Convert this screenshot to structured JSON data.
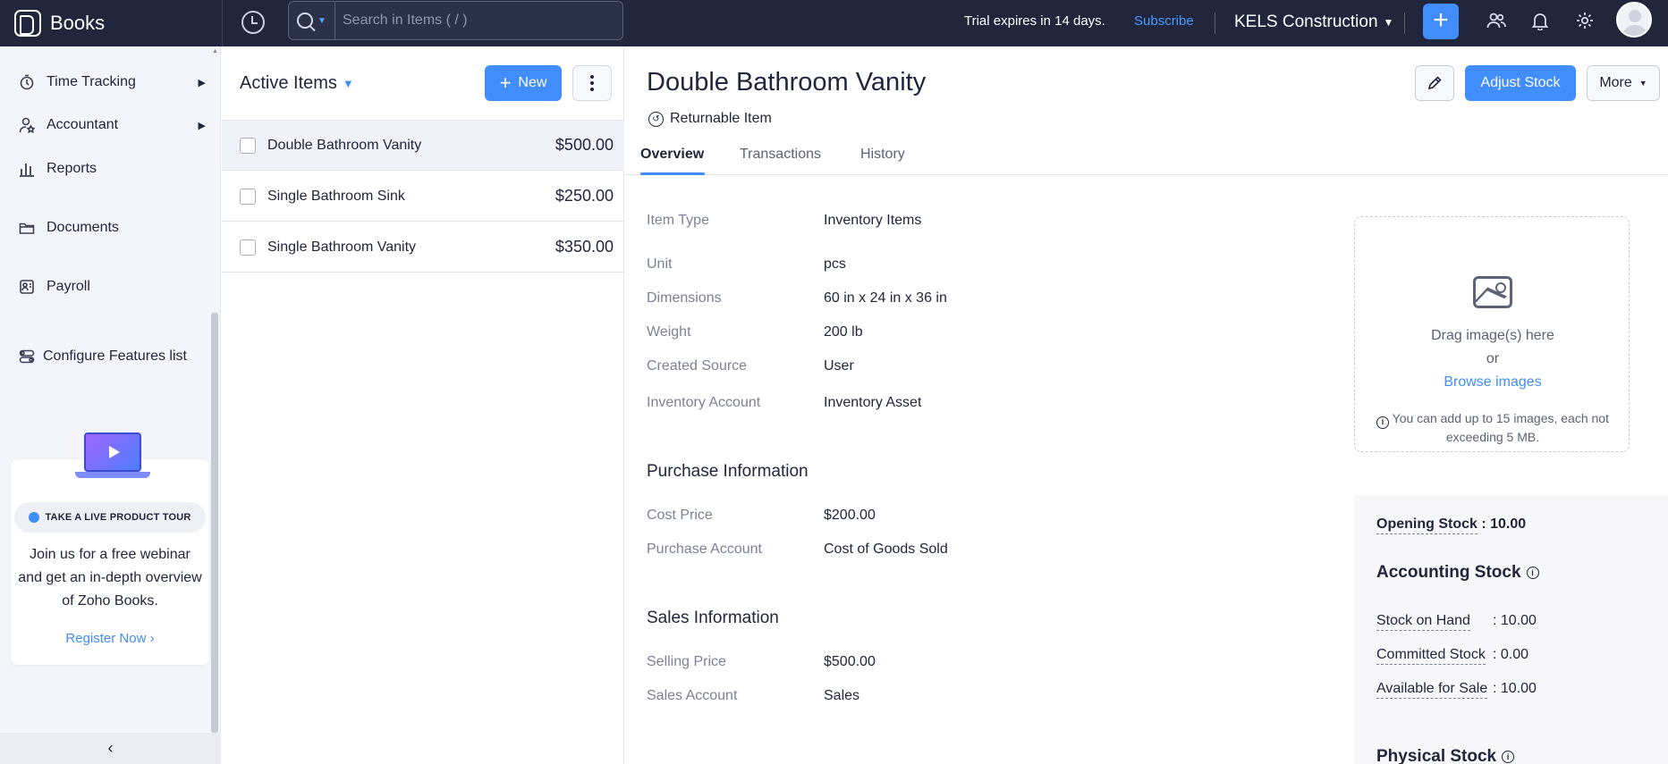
{
  "topbar": {
    "app_name": "Books",
    "search_placeholder": "Search in Items ( / )",
    "trial_text": "Trial expires in 14 days.",
    "subscribe_label": "Subscribe",
    "org_name": "KELS Construction"
  },
  "sidebar": {
    "items": [
      {
        "label": "Time Tracking",
        "icon": "stopwatch-icon",
        "has_submenu": true
      },
      {
        "label": "Accountant",
        "icon": "accountant-icon",
        "has_submenu": true
      },
      {
        "label": "Reports",
        "icon": "bar-chart-icon",
        "has_submenu": false
      },
      {
        "label": "Documents",
        "icon": "folder-icon",
        "has_submenu": false
      },
      {
        "label": "Payroll",
        "icon": "payroll-icon",
        "has_submenu": false
      },
      {
        "label": "Configure Features list",
        "icon": "toggle-icon",
        "has_submenu": false
      }
    ],
    "promo": {
      "badge": "TAKE A LIVE PRODUCT TOUR",
      "text": "Join us for a free webinar and get an in-depth overview of Zoho Books.",
      "link": "Register Now"
    }
  },
  "list": {
    "title": "Active Items",
    "new_label": "New",
    "rows": [
      {
        "name": "Double Bathroom Vanity",
        "price": "$500.00",
        "active": true
      },
      {
        "name": "Single Bathroom Sink",
        "price": "$250.00",
        "active": false
      },
      {
        "name": "Single Bathroom Vanity",
        "price": "$350.00",
        "active": false
      }
    ]
  },
  "detail": {
    "title": "Double Bathroom Vanity",
    "returnable": "Returnable Item",
    "adjust_label": "Adjust Stock",
    "more_label": "More",
    "tabs": [
      "Overview",
      "Transactions",
      "History"
    ],
    "fields": [
      {
        "label": "Item Type",
        "value": "Inventory Items"
      },
      {
        "label": "Unit",
        "value": "pcs"
      },
      {
        "label": "Dimensions",
        "value": "60 in x 24 in x 36 in"
      },
      {
        "label": "Weight",
        "value": "200 lb"
      },
      {
        "label": "Created Source",
        "value": "User"
      },
      {
        "label": "Inventory Account",
        "value": "Inventory Asset"
      }
    ],
    "purchase": {
      "title": "Purchase Information",
      "fields": [
        {
          "label": "Cost Price",
          "value": "$200.00"
        },
        {
          "label": "Purchase Account",
          "value": "Cost of Goods Sold"
        }
      ]
    },
    "sales": {
      "title": "Sales Information",
      "fields": [
        {
          "label": "Selling Price",
          "value": "$500.00"
        },
        {
          "label": "Sales Account",
          "value": "Sales"
        }
      ]
    },
    "dropzone": {
      "line1": "Drag image(s) here",
      "line2": "or",
      "link": "Browse images",
      "note": "You can add up to 15 images, each not exceeding 5 MB."
    },
    "stock": {
      "opening_label": "Opening Stock",
      "opening_value": ": 10.00",
      "accounting_title": "Accounting Stock",
      "rows": [
        {
          "label": "Stock on Hand",
          "value": ": 10.00"
        },
        {
          "label": "Committed Stock",
          "value": ": 0.00"
        },
        {
          "label": "Available for Sale",
          "value": ": 10.00"
        }
      ],
      "physical_title": "Physical Stock"
    }
  }
}
